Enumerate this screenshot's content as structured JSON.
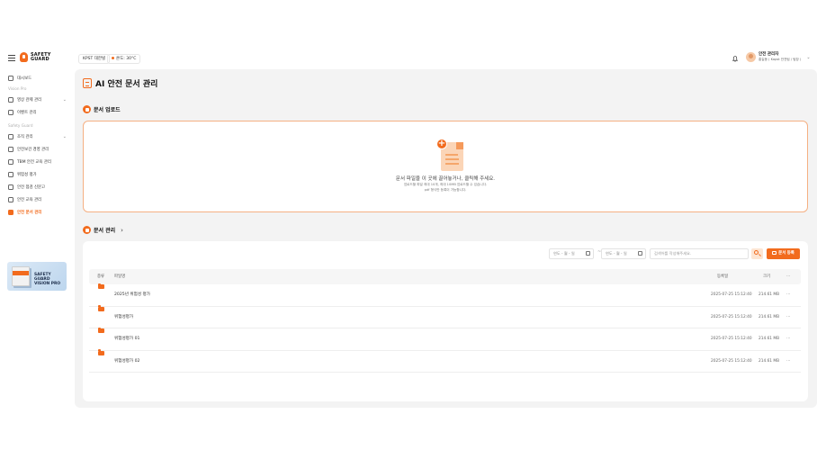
{
  "header": {
    "logo": {
      "line1": "SAFETY",
      "line2": "GUARD"
    },
    "site": "KPST 대한빌",
    "temperature": "온도: 30°C",
    "user": {
      "name": "안전 관리자",
      "org": "홍길동 ( Kapst 안전팀 / 팀장 )"
    }
  },
  "sidebar": {
    "items": [
      {
        "label": "대시보드",
        "icon": "dashboard-icon"
      },
      {
        "section": "Vision Pro"
      },
      {
        "label": "영상 관제 관리",
        "icon": "video-icon",
        "expandable": true
      },
      {
        "label": "이벤트 관리",
        "icon": "event-icon"
      },
      {
        "section": "Safety Guard"
      },
      {
        "label": "조직 관리",
        "icon": "organization-icon",
        "expandable": true
      },
      {
        "label": "안전보건 경영 관리",
        "icon": "management-icon"
      },
      {
        "label": "TBM 안전 교육 관리",
        "icon": "tbm-icon"
      },
      {
        "label": "위험성 평가",
        "icon": "risk-icon"
      },
      {
        "label": "안전 점검 신문고",
        "icon": "inspection-icon"
      },
      {
        "label": "안전 교육 관리",
        "icon": "education-icon"
      },
      {
        "label": "안전 문서 관리",
        "icon": "document-icon",
        "active": true
      }
    ],
    "banner": {
      "line1": "SAFETY GUARD",
      "line2": "VISION PRO"
    }
  },
  "page": {
    "title": "AI 안전 문서 관리"
  },
  "upload": {
    "heading": "문서 업로드",
    "main_text": "문서 파일을 이 곳에 끌어놓거나, 클릭해 주세요.",
    "sub_text_1": "업로드할 파일 최대 10개, 최대 10MB 업로드할 수 있습니다.",
    "sub_text_2": "pdf 형식만 등록이 가능합니다."
  },
  "documents": {
    "heading": "문서 관리",
    "date_from_placeholder": "연도 - 월 - 일",
    "date_to_placeholder": "연도 - 월 - 일",
    "search_placeholder": "검색어를 작성해주세요.",
    "upload_button": "문서 등록",
    "columns": {
      "type": "종류",
      "name": "파일명",
      "date": "등록일",
      "size": "크기",
      "more": "···"
    },
    "rows": [
      {
        "name": "2025년 위험성 평가",
        "date": "2025-07-25 15:12:40",
        "size": "214.61 MB"
      },
      {
        "name": "위험성평가",
        "date": "2025-07-25 15:12:40",
        "size": "214.61 MB"
      },
      {
        "name": "위험성평가 01",
        "date": "2025-07-25 15:12:40",
        "size": "214.61 MB"
      },
      {
        "name": "위험성평가 02",
        "date": "2025-07-25 15:12:40",
        "size": "214.61 MB"
      }
    ],
    "row_more": "···"
  },
  "colors": {
    "accent": "#f26b1d",
    "background": "#f3f3f3"
  }
}
